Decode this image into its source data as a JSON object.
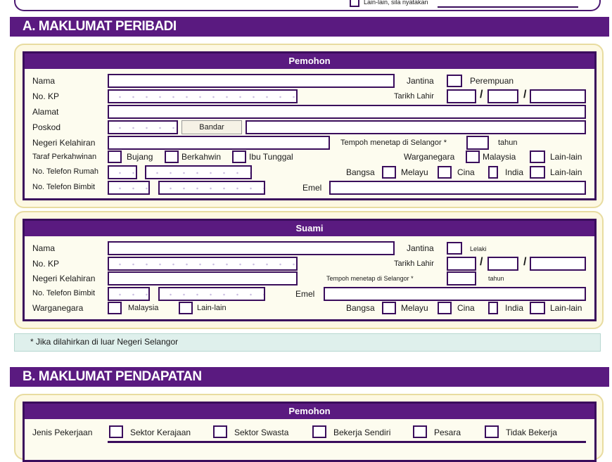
{
  "top": {
    "other_label": "Lain-lain, sila nyatakan"
  },
  "section_a": {
    "title": "A. MAKLUMAT PERIBADI",
    "applicant": {
      "title": "Pemohon",
      "nama": "Nama",
      "jantina": "Jantina",
      "perempuan": "Perempuan",
      "no_kp": "No. KP",
      "tarikh_lahir": "Tarikh Lahir",
      "alamat": "Alamat",
      "poskod": "Poskod",
      "bandar": "Bandar",
      "negeri_kelahiran": "Negeri Kelahiran",
      "tempoh": "Tempoh menetap di Selangor *",
      "tahun": "tahun",
      "taraf": "Taraf Perkahwinan",
      "bujang": "Bujang",
      "berkahwin": "Berkahwin",
      "ibu_tunggal": "Ibu Tunggal",
      "warganegara": "Warganegara",
      "malaysia": "Malaysia",
      "lain_lain": "Lain-lain",
      "tel_rumah": "No. Telefon Rumah",
      "bangsa": "Bangsa",
      "melayu": "Melayu",
      "cina": "Cina",
      "india": "India",
      "tel_bimbit": "No. Telefon Bimbit",
      "emel": "Emel"
    },
    "spouse": {
      "title": "Suami",
      "nama": "Nama",
      "jantina": "Jantina",
      "lelaki": "Lelaki",
      "no_kp": "No. KP",
      "tarikh_lahir": "Tarikh Lahir",
      "negeri_kelahiran": "Negeri Kelahiran",
      "tempoh": "Tempoh menetap di Selangor *",
      "tahun": "tahun",
      "tel_bimbit": "No. Telefon Bimbit",
      "emel": "Emel",
      "warganegara": "Warganegara",
      "malaysia": "Malaysia",
      "lain_lain": "Lain-lain",
      "bangsa": "Bangsa",
      "melayu": "Melayu",
      "cina": "Cina",
      "india": "India"
    },
    "footnote": "* Jika dilahirkan di luar Negeri Selangor"
  },
  "section_b": {
    "title": "B. MAKLUMAT PENDAPATAN",
    "applicant": {
      "title": "Pemohon",
      "jenis": "Jenis Pekerjaan",
      "kerajaan": "Sektor Kerajaan",
      "swasta": "Sektor Swasta",
      "sendiri": "Bekerja Sendiri",
      "pesara": "Pesara",
      "tidak": "Tidak Bekerja"
    }
  },
  "colors": {
    "purple": "#5a1a80",
    "border": "#3a0d5c",
    "panel": "#fdf8e2",
    "note": "#dff0ec"
  }
}
